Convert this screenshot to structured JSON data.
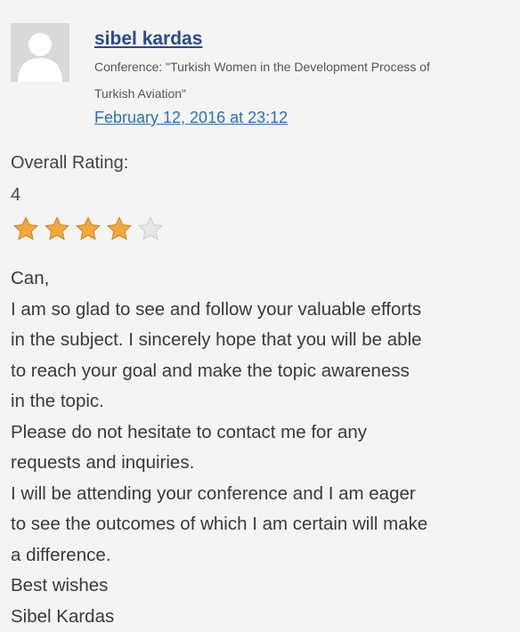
{
  "comment": {
    "author": "sibel kardas",
    "conference_line_1": "Conference: \"Turkish Women in the Development Process of",
    "conference_line_2": "Turkish Aviation\"",
    "date": "February 12, 2016 at 23:12",
    "rating_label": "Overall Rating:",
    "rating_value": "4",
    "stars": {
      "filled": 4,
      "total": 5,
      "filled_color": "#f0a93a",
      "empty_color": "#e6e6e6"
    },
    "body_lines": [
      "Can,",
      "I am so glad to see and follow your valuable efforts",
      "in the subject. I sincerely hope that you will be able",
      "to reach your goal and make the topic awareness",
      "in the topic.",
      "Please do not hesitate to contact me for any",
      "requests and inquiries.",
      "I will be attending your conference and I am eager",
      "to see the outcomes of which I am certain will make",
      "a difference.",
      "Best wishes",
      "Sibel Kardas"
    ]
  },
  "colors": {
    "link": "#2a4a8c",
    "date_link": "#2f6fba",
    "background": "#f4f4f4"
  }
}
